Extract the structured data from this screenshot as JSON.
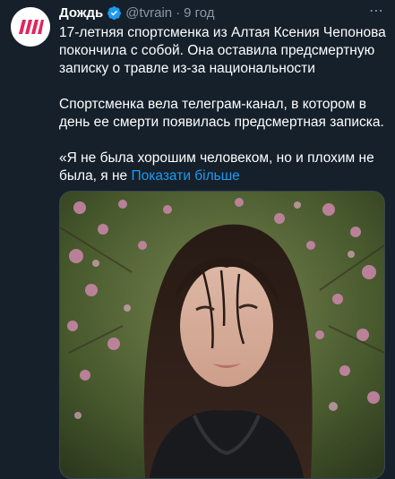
{
  "tweet": {
    "author": {
      "name": "Дождь",
      "handle": "@tvrain",
      "separator": "·",
      "time": "9 год"
    },
    "menu_glyph": "⋯",
    "paragraphs": [
      "17-летняя спортсменка из Алтая Ксения Чепонова покончила с собой. Она оставила предсмертную записку о травле из-за национальности",
      "Спортсменка вела телеграм-канал, в котором в день ее смерти появилась предсмертная записка."
    ],
    "quote_text": "«Я не была хорошим человеком, но и плохим не была, я не",
    "show_more_label": "Показати більше",
    "colors": {
      "background": "#15202b",
      "accent": "#1d9bf0",
      "secondary_text": "#8b98a5",
      "logo_red": "#e0245e"
    },
    "icons": [
      "tvrain-logo-icon",
      "verified-badge-icon",
      "more-options-icon"
    ]
  }
}
